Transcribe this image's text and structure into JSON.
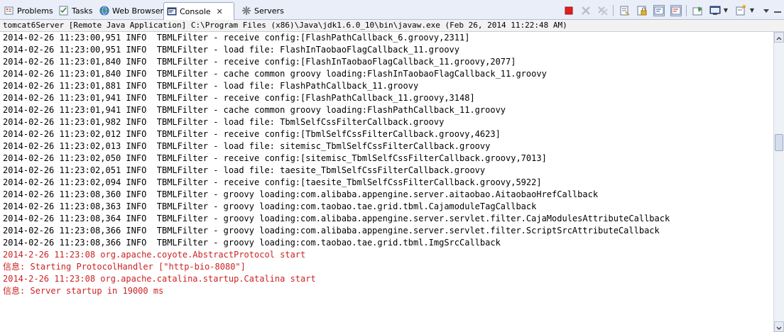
{
  "tabs": [
    {
      "label": "Problems",
      "icon": "problems-icon"
    },
    {
      "label": "Tasks",
      "icon": "tasks-icon"
    },
    {
      "label": "Web Browser",
      "icon": "globe-icon"
    },
    {
      "label": "Console",
      "icon": "console-icon",
      "active": true
    },
    {
      "label": "Servers",
      "icon": "servers-icon"
    }
  ],
  "toolbar": [
    "terminate-icon",
    "remove-launch-icon",
    "remove-all-terminated-icon",
    "clear-console-icon",
    "scroll-lock-icon",
    "show-console-on-stdout-icon",
    "show-console-on-stderr-icon",
    "pin-console-icon",
    "display-selected-console-icon",
    "open-console-icon"
  ],
  "colors": {
    "error_text": "#cc2222",
    "terminate": "#e02020"
  },
  "console": {
    "description": "tomcat6Server [Remote Java Application] C:\\Program Files (x86)\\Java\\jdk1.6.0_10\\bin\\javaw.exe (Feb 26, 2014 11:22:48 AM)",
    "lines": [
      {
        "text": "2014-02-26 11:23:00,951 INFO  TBMLFilter - receive config:[FlashPathCallback_6.groovy,2311]",
        "stream": "stdout"
      },
      {
        "text": "2014-02-26 11:23:00,951 INFO  TBMLFilter - load file: FlashInTaobaoFlagCallback_11.groovy",
        "stream": "stdout"
      },
      {
        "text": "2014-02-26 11:23:01,840 INFO  TBMLFilter - receive config:[FlashInTaobaoFlagCallback_11.groovy,2077]",
        "stream": "stdout"
      },
      {
        "text": "2014-02-26 11:23:01,840 INFO  TBMLFilter - cache common groovy loading:FlashInTaobaoFlagCallback_11.groovy",
        "stream": "stdout"
      },
      {
        "text": "2014-02-26 11:23:01,881 INFO  TBMLFilter - load file: FlashPathCallback_11.groovy",
        "stream": "stdout"
      },
      {
        "text": "2014-02-26 11:23:01,941 INFO  TBMLFilter - receive config:[FlashPathCallback_11.groovy,3148]",
        "stream": "stdout"
      },
      {
        "text": "2014-02-26 11:23:01,941 INFO  TBMLFilter - cache common groovy loading:FlashPathCallback_11.groovy",
        "stream": "stdout"
      },
      {
        "text": "2014-02-26 11:23:01,982 INFO  TBMLFilter - load file: TbmlSelfCssFilterCallback.groovy",
        "stream": "stdout"
      },
      {
        "text": "2014-02-26 11:23:02,012 INFO  TBMLFilter - receive config:[TbmlSelfCssFilterCallback.groovy,4623]",
        "stream": "stdout"
      },
      {
        "text": "2014-02-26 11:23:02,013 INFO  TBMLFilter - load file: sitemisc_TbmlSelfCssFilterCallback.groovy",
        "stream": "stdout"
      },
      {
        "text": "2014-02-26 11:23:02,050 INFO  TBMLFilter - receive config:[sitemisc_TbmlSelfCssFilterCallback.groovy,7013]",
        "stream": "stdout"
      },
      {
        "text": "2014-02-26 11:23:02,051 INFO  TBMLFilter - load file: taesite_TbmlSelfCssFilterCallback.groovy",
        "stream": "stdout"
      },
      {
        "text": "2014-02-26 11:23:02,094 INFO  TBMLFilter - receive config:[taesite_TbmlSelfCssFilterCallback.groovy,5922]",
        "stream": "stdout"
      },
      {
        "text": "2014-02-26 11:23:08,360 INFO  TBMLFilter - groovy loading:com.alibaba.appengine.server.aitaobao.AitaobaoHrefCallback",
        "stream": "stdout"
      },
      {
        "text": "2014-02-26 11:23:08,363 INFO  TBMLFilter - groovy loading:com.taobao.tae.grid.tbml.CajamoduleTagCallback",
        "stream": "stdout"
      },
      {
        "text": "2014-02-26 11:23:08,364 INFO  TBMLFilter - groovy loading:com.alibaba.appengine.server.servlet.filter.CajaModulesAttributeCallback",
        "stream": "stdout"
      },
      {
        "text": "2014-02-26 11:23:08,366 INFO  TBMLFilter - groovy loading:com.alibaba.appengine.server.servlet.filter.ScriptSrcAttributeCallback",
        "stream": "stdout"
      },
      {
        "text": "2014-02-26 11:23:08,366 INFO  TBMLFilter - groovy loading:com.taobao.tae.grid.tbml.ImgSrcCallback",
        "stream": "stdout"
      },
      {
        "text": "2014-2-26 11:23:08 org.apache.coyote.AbstractProtocol start",
        "stream": "stderr"
      },
      {
        "text": "信息: Starting ProtocolHandler [\"http-bio-8080\"]",
        "stream": "stderr"
      },
      {
        "text": "2014-2-26 11:23:08 org.apache.catalina.startup.Catalina start",
        "stream": "stderr"
      },
      {
        "text": "信息: Server startup in 19000 ms",
        "stream": "stderr"
      }
    ]
  },
  "scrollbar": {
    "position": 0.35,
    "visible_fraction": 0.06
  }
}
